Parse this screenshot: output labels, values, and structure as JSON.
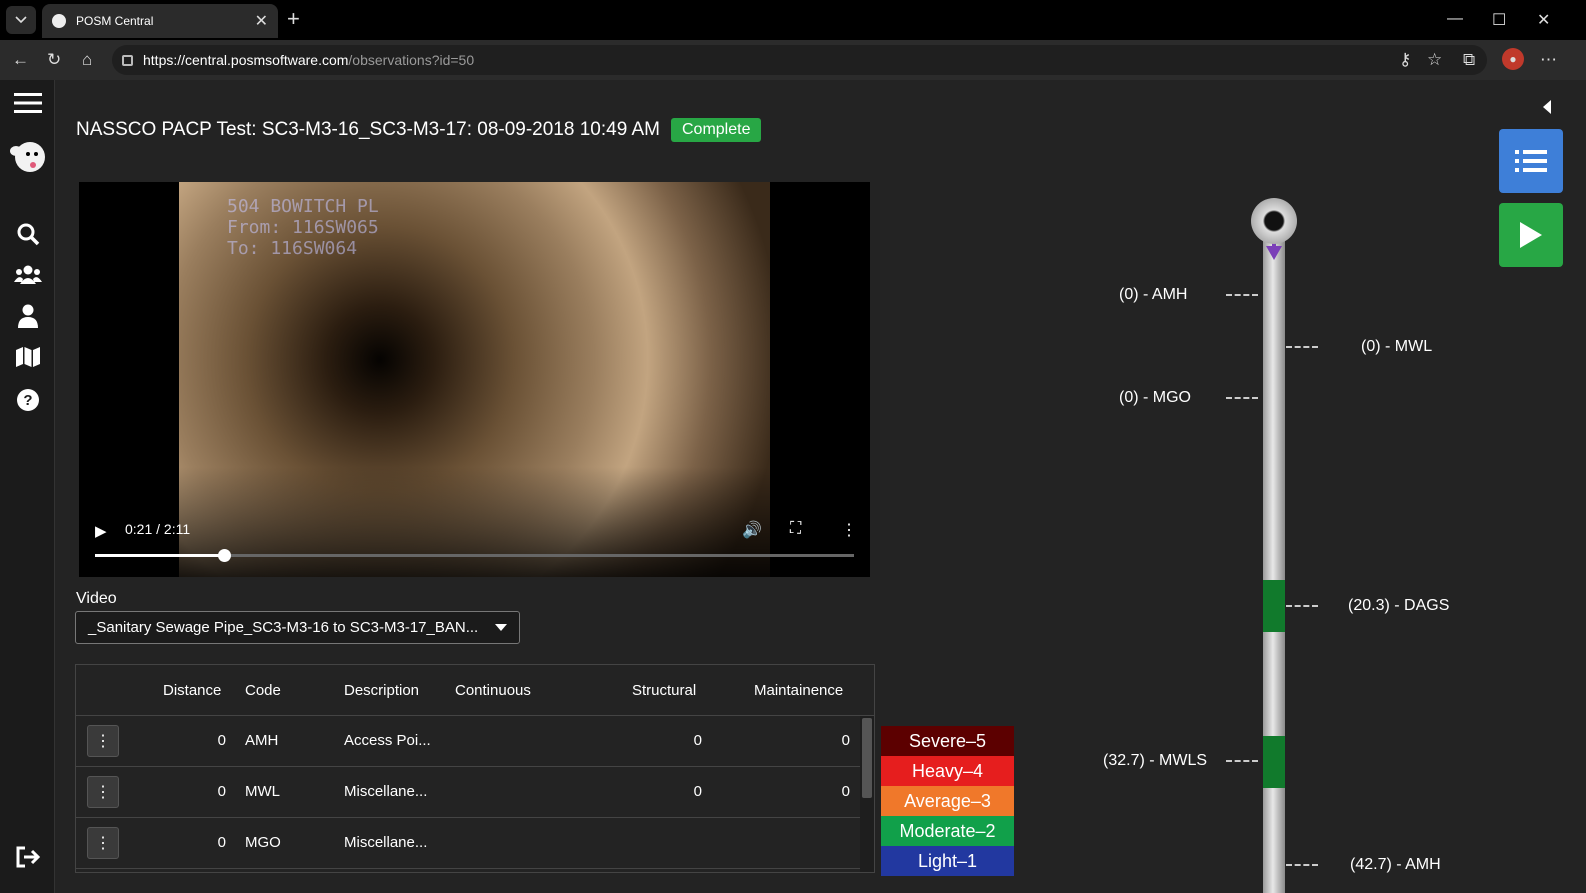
{
  "browser": {
    "tab_title": "POSM Central",
    "url_host": "https://central.posmsoftware.com",
    "url_path": "/observations?id=50"
  },
  "page": {
    "title": "NASSCO PACP Test: SC3-M3-16_SC3-M3-17: 08-09-2018 10:49 AM",
    "status": "Complete"
  },
  "video": {
    "overlay_text": "504 BOWITCH PL\nFrom: 116SW065\nTo: 116SW064",
    "time": "0:21 / 2:11",
    "progress_fraction": 0.17,
    "label": "Video",
    "selected": "_Sanitary Sewage Pipe_SC3-M3-16 to SC3-M3-17_BAN..."
  },
  "table": {
    "headers": {
      "distance": "Distance",
      "code": "Code",
      "description": "Description",
      "continuous": "Continuous",
      "structural": "Structural",
      "maintainence": "Maintainence"
    },
    "rows": [
      {
        "distance": "0",
        "code": "AMH",
        "description": "Access Poi...",
        "continuous": "",
        "structural": "0",
        "maintainence": "0"
      },
      {
        "distance": "0",
        "code": "MWL",
        "description": "Miscellane...",
        "continuous": "",
        "structural": "0",
        "maintainence": "0"
      },
      {
        "distance": "0",
        "code": "MGO",
        "description": "Miscellane...",
        "continuous": "",
        "structural": "",
        "maintainence": ""
      }
    ]
  },
  "legend": [
    {
      "label": "Severe–5",
      "color": "#5c0000"
    },
    {
      "label": "Heavy–4",
      "color": "#e61e1e"
    },
    {
      "label": "Average–3",
      "color": "#f0782a"
    },
    {
      "label": "Moderate–2",
      "color": "#11a04a"
    },
    {
      "label": "Light–1",
      "color": "#2238a0"
    }
  ],
  "pipe": {
    "labels": {
      "amh_start": "(0) - AMH",
      "mwl": "(0) - MWL",
      "mgo": "(0) - MGO",
      "dags": "(20.3) - DAGS",
      "mwls": "(32.7) - MWLS",
      "amh_end": "(42.7) - AMH"
    }
  },
  "colors": {
    "accent_blue": "#3e7fd8",
    "accent_green": "#28a745",
    "pipe_defect": "#117a2c",
    "flow_arrow": "#7b3fb8"
  },
  "icons": {
    "sidebar": [
      "menu-icon",
      "posm-logo",
      "search-icon",
      "users-icon",
      "user-icon",
      "map-icon",
      "help-icon",
      "logout-icon"
    ],
    "right": [
      "list-icon",
      "play-icon"
    ]
  }
}
